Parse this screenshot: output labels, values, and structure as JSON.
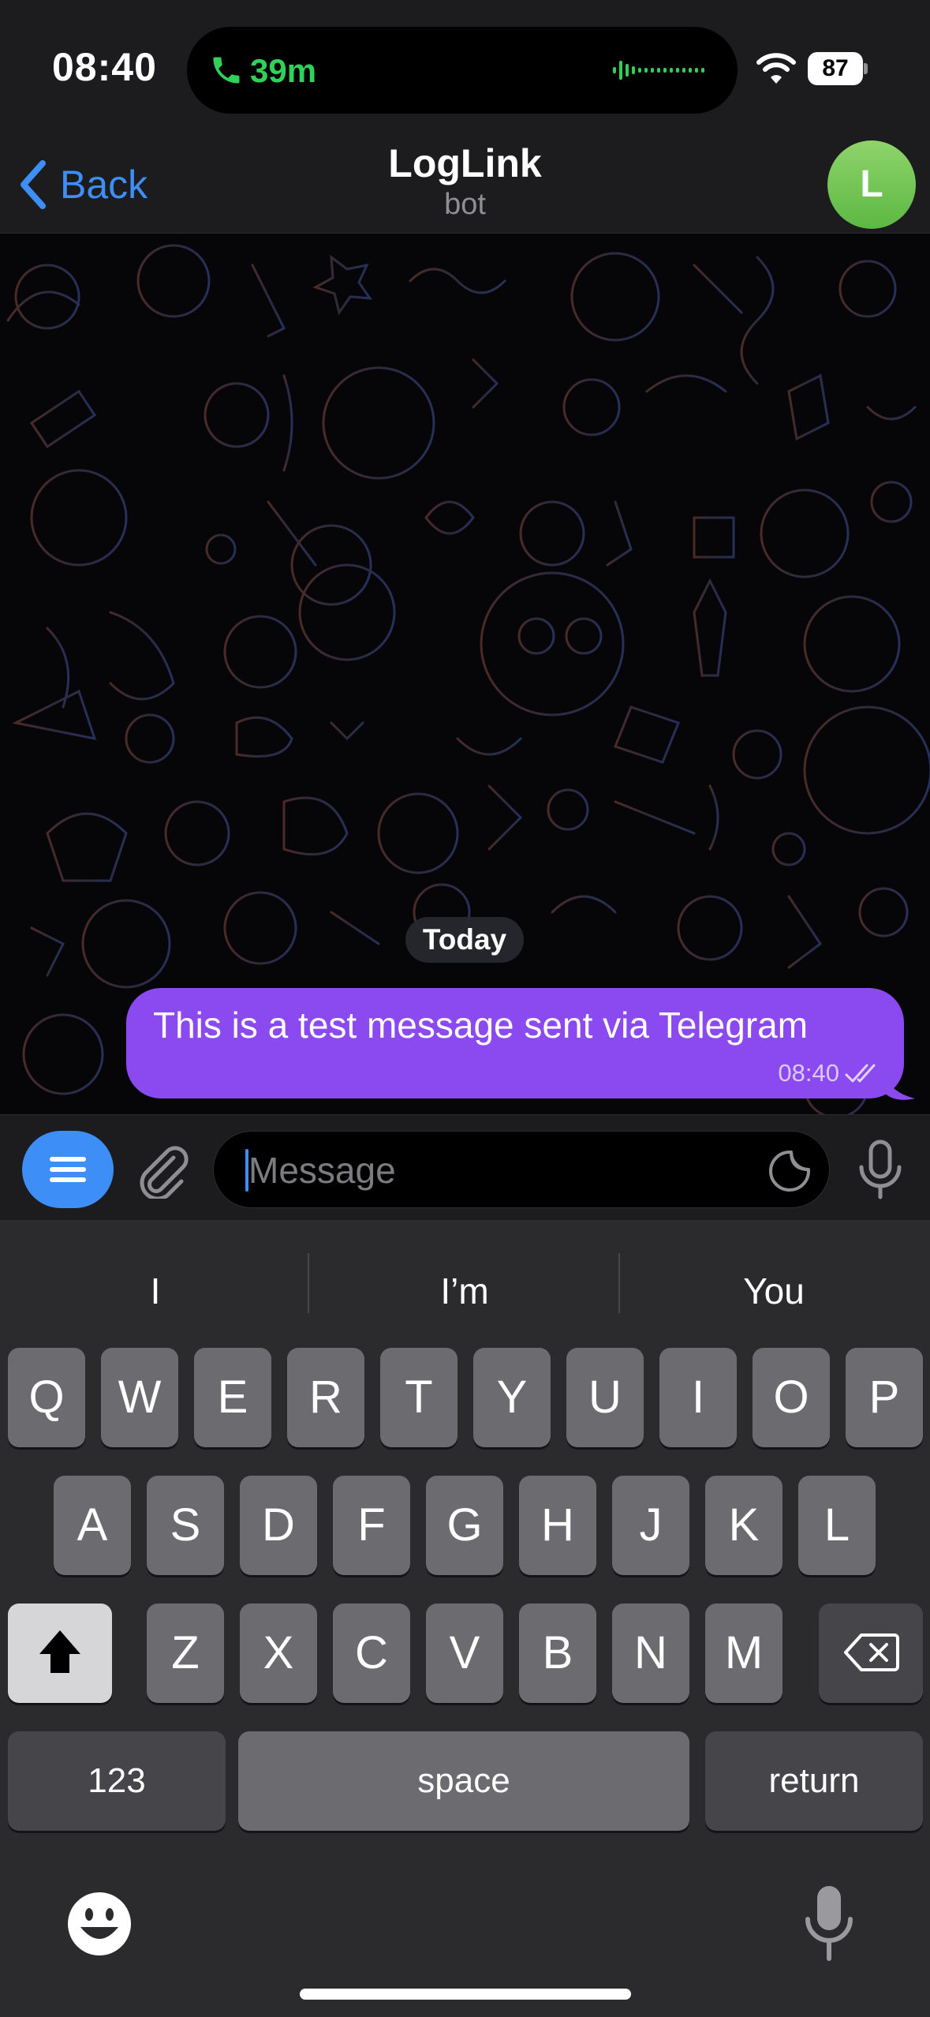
{
  "status_bar": {
    "time": "08:40",
    "call_duration": "39m",
    "battery": "87"
  },
  "nav": {
    "back_label": "Back",
    "title": "LogLink",
    "subtitle": "bot",
    "avatar_initial": "L"
  },
  "chat": {
    "date_label": "Today",
    "messages": [
      {
        "text": "This is a test message sent via Telegram",
        "time": "08:40",
        "status": "read",
        "outgoing": true
      }
    ]
  },
  "input": {
    "placeholder": "Message"
  },
  "keyboard": {
    "suggestions": [
      "I",
      "I’m",
      "You"
    ],
    "row1": [
      "Q",
      "W",
      "E",
      "R",
      "T",
      "Y",
      "U",
      "I",
      "O",
      "P"
    ],
    "row2": [
      "A",
      "S",
      "D",
      "F",
      "G",
      "H",
      "J",
      "K",
      "L"
    ],
    "row3": [
      "Z",
      "X",
      "C",
      "V",
      "B",
      "N",
      "M"
    ],
    "numbers_label": "123",
    "space_label": "space",
    "return_label": "return"
  },
  "colors": {
    "accent": "#3e8ef7",
    "bubble": "#8b4af0",
    "call_green": "#30d158",
    "avatar": "#6ec24f"
  }
}
